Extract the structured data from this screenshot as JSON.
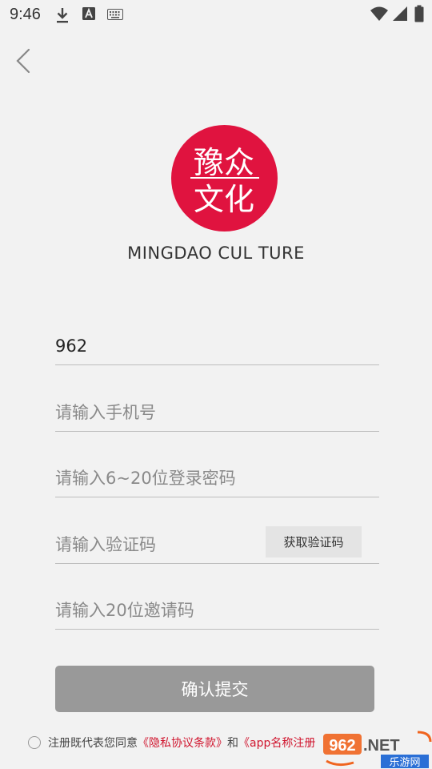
{
  "status_bar": {
    "time": "9:46",
    "icons": [
      "download-icon",
      "a-icon",
      "keyboard-icon",
      "wifi-icon",
      "signal-icon",
      "battery-icon"
    ]
  },
  "back_icon": "chevron-left-icon",
  "logo": {
    "glyph_lines": [
      "豫众",
      "文化"
    ],
    "color": "#e0133f"
  },
  "brand": {
    "name": "MINGDAO CUL TURE"
  },
  "form": {
    "field1_value": "962",
    "phone_placeholder": "请输入手机号",
    "password_placeholder": "请输入6~20位登录密码",
    "code_placeholder": "请输入验证码",
    "get_code_label": "获取验证码",
    "invite_placeholder": "请输入20位邀请码",
    "submit_label": "确认提交"
  },
  "agreement": {
    "prefix": "注册既代表您同意",
    "privacy_link": "《隐私协议条款》",
    "connector": "和",
    "terms_link": "《app名称注册"
  },
  "watermark": {
    "number": "962",
    "suffix": ".NET",
    "site": "乐游网"
  },
  "colors": {
    "background": "#f2f2f2",
    "accent": "#e0133f",
    "link": "#d0152e",
    "button_disabled": "#999999"
  }
}
